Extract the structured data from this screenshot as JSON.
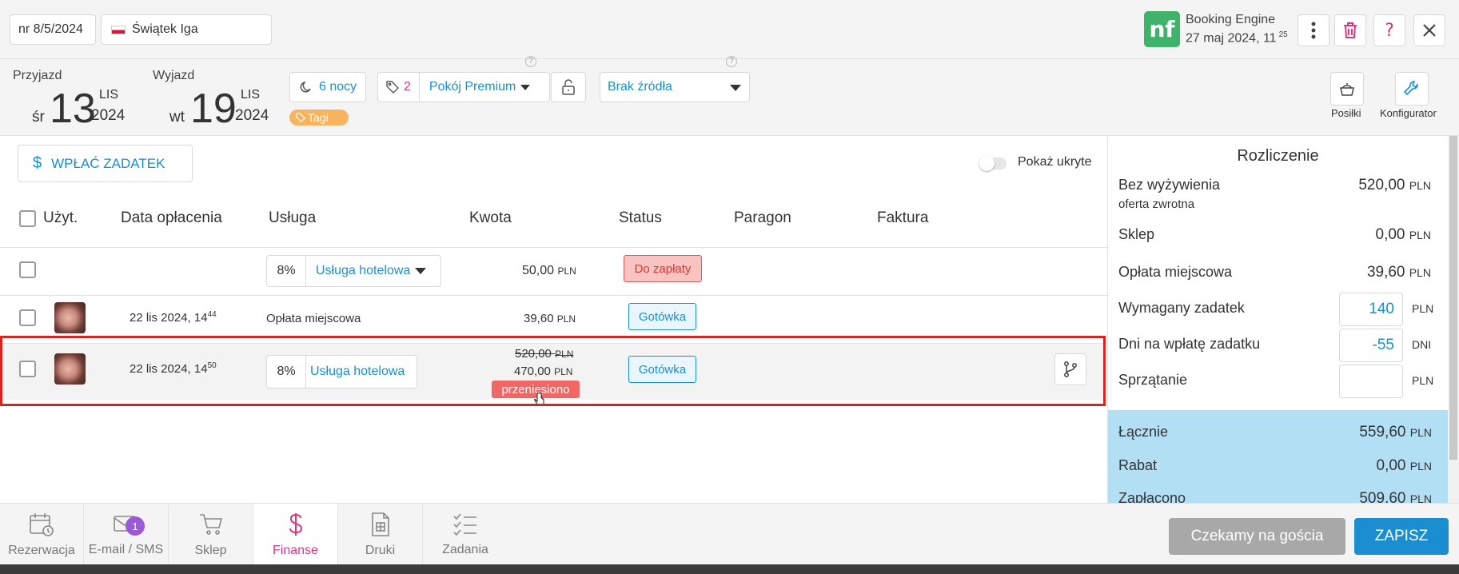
{
  "header": {
    "reservation_no": "nr 8/5/2024",
    "guest_name": "Świątek Iga",
    "source_logo": "nf",
    "source_name": "Booking Engine",
    "source_date": "27 maj 2024, 11",
    "source_time_sup": "25"
  },
  "stay": {
    "arrival_label": "Przyjazd",
    "arrival_dow": "śr",
    "arrival_day": "13",
    "arrival_month": "LIS",
    "arrival_year": "2024",
    "departure_label": "Wyjazd",
    "departure_dow": "wt",
    "departure_day": "19",
    "departure_month": "LIS",
    "departure_year": "2024",
    "nights": "6 nocy",
    "tags_count": "2",
    "room_type": "Pokój Premium",
    "tags_label": "Tagi",
    "source_select": "Brak źródła"
  },
  "tools": {
    "meals": "Posiłki",
    "configurator": "Konfigurator"
  },
  "toolbar": {
    "deposit_button": "WPŁAĆ ZADATEK",
    "show_hidden": "Pokaż ukryte"
  },
  "table": {
    "headers": [
      "Użyt.",
      "Data opłacenia",
      "Usługa",
      "Kwota",
      "Status",
      "Paragon",
      "Faktura"
    ],
    "rows": [
      {
        "date": "",
        "date_sup": "",
        "vat": "8%",
        "service": "Usługa hotelowa",
        "amount_old": "",
        "amount": "50,00",
        "currency": "PLN",
        "status": "Do zapłaty",
        "moved": ""
      },
      {
        "date": "22 lis 2024, 14",
        "date_sup": "44",
        "vat": "",
        "service": "Opłata miejscowa",
        "amount_old": "",
        "amount": "39,60",
        "currency": "PLN",
        "status": "Gotówka",
        "moved": ""
      },
      {
        "date": "22 lis 2024, 14",
        "date_sup": "50",
        "vat": "8%",
        "service": "Usługa hotelowa",
        "amount_old": "520,00",
        "amount": "470,00",
        "currency": "PLN",
        "status": "Gotówka",
        "moved": "przeniesiono"
      }
    ]
  },
  "settlement": {
    "title": "Rozliczenie",
    "board_label": "Bez wyżywienia",
    "board_sub": "oferta zwrotna",
    "board_value": "520,00",
    "shop_label": "Sklep",
    "shop_value": "0,00",
    "city_tax_label": "Opłata miejscowa",
    "city_tax_value": "39,60",
    "deposit_required_label": "Wymagany zadatek",
    "deposit_required_value": "140",
    "deposit_days_label": "Dni na wpłatę zadatku",
    "deposit_days_value": "-55",
    "days_unit": "DNI",
    "cleaning_label": "Sprzątanie",
    "cleaning_value": "",
    "total_label": "Łącznie",
    "total_value": "559,60",
    "discount_label": "Rabat",
    "discount_value": "0,00",
    "paid_label": "Zapłacono",
    "paid_value": "509,60",
    "currency": "PLN"
  },
  "footer_tabs": [
    {
      "label": "Rezerwacja",
      "icon": "calendar-clock-icon"
    },
    {
      "label": "E-mail / SMS",
      "icon": "mail-icon",
      "badge": "1"
    },
    {
      "label": "Sklep",
      "icon": "cart-icon"
    },
    {
      "label": "Finanse",
      "icon": "dollar-icon"
    },
    {
      "label": "Druki",
      "icon": "document-icon"
    },
    {
      "label": "Zadania",
      "icon": "checklist-icon"
    }
  ],
  "actions": {
    "status_button": "Czekamy na gościa",
    "save_button": "ZAPISZ"
  },
  "colors": {
    "accent_blue": "#1a8ed1",
    "pink": "#e0337c",
    "summary_bg": "#b3dff5",
    "highlight_border": "#e0201b",
    "logo_green": "#3fb36a"
  }
}
